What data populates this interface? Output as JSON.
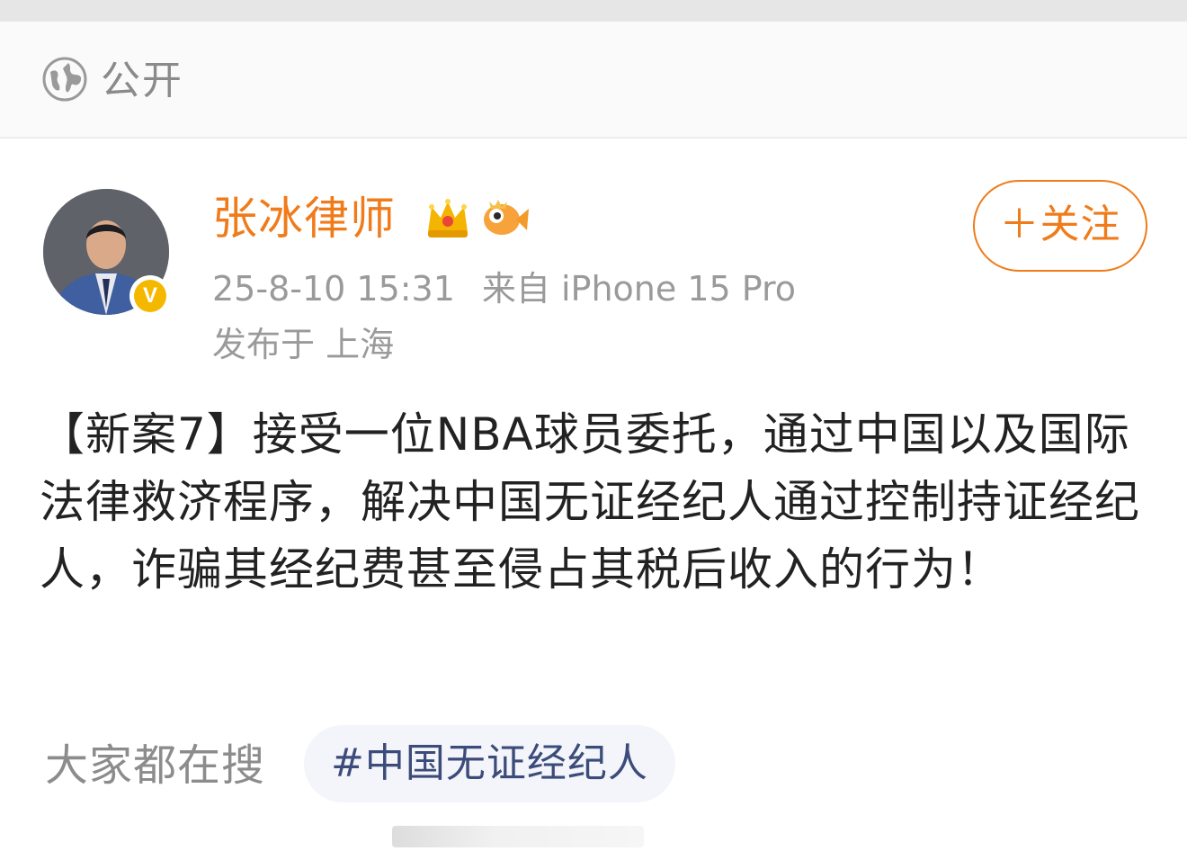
{
  "visibility": {
    "icon": "globe-icon",
    "label": "公开"
  },
  "post": {
    "author": {
      "name": "张冰律师",
      "avatar": "avatar",
      "verified_badge": "V",
      "badges": [
        "crown-icon",
        "fish-icon"
      ]
    },
    "timestamp": "25-8-10 15:31",
    "source": "来自 iPhone 15 Pro",
    "location": "发布于 上海",
    "follow_label": "＋关注",
    "body": "【新案7】接受一位NBA球员委托，通过中国以及国际法律救济程序，解决中国无证经纪人通过控制持证经纪人，诈骗其经纪费甚至侵占其税后收入的行为！"
  },
  "trending": {
    "label": "大家都在搜",
    "topic": "#中国无证经纪人"
  },
  "colors": {
    "accent": "#f07b1a",
    "muted_text": "#9a9a9a",
    "body_text": "#222222",
    "topic_text": "#3c4c7a",
    "verify": "#f5b800"
  }
}
